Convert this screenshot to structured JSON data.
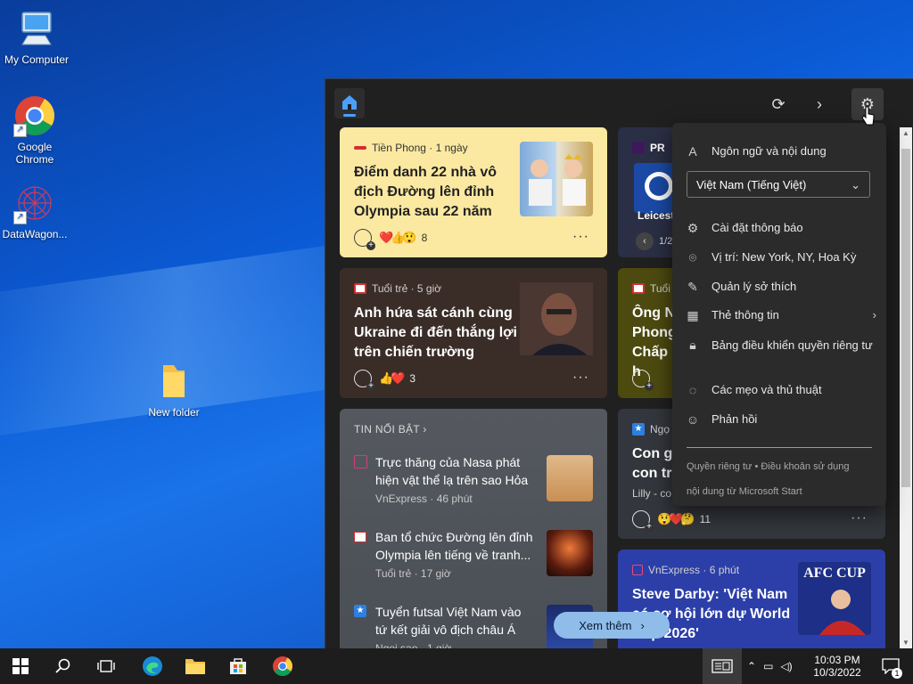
{
  "desktop": {
    "icons": [
      {
        "label": "My Computer"
      },
      {
        "label": "Google Chrome"
      },
      {
        "label": "DataWagon..."
      },
      {
        "label": "New folder"
      }
    ]
  },
  "panel": {
    "cards": {
      "c1": {
        "source": "Tiền Phong · 1 ngày",
        "headline": "Điểm danh 22 nhà vô địch Đường lên đỉnh Olympia sau 22 năm",
        "count": "8"
      },
      "c2": {
        "source": "PR",
        "team": "Leicester",
        "page": "1/2"
      },
      "c3": {
        "source": "Tuổi trẻ · 5 giờ",
        "headline": "Anh hứa sát cánh cùng Ukraine đi đến thắng lợi trên chiến trường",
        "count": "3"
      },
      "c4": {
        "source": "Tuổi",
        "headline": "Ông N Phong Chấp h"
      },
      "c5": {
        "source": "Ngọ",
        "headline": "Con ga con tra",
        "author": "Lilly - co",
        "count": "11"
      },
      "c6": {
        "source": "VnExpress · 6 phút",
        "headline": "Steve Darby: 'Việt Nam có cơ hội lớn dự World Cup 2026'",
        "thumb_text": "AFC CUP"
      }
    },
    "trending": {
      "title": "TIN NỔI BẬT",
      "items": [
        {
          "headline": "Trực thăng của Nasa phát hiện vật thể lạ trên sao Hỏa",
          "meta": "VnExpress · 46 phút"
        },
        {
          "headline": "Ban tổ chức Đường lên đỉnh Olympia lên tiếng về tranh...",
          "meta": "Tuổi trẻ · 17 giờ"
        },
        {
          "headline": "Tuyển futsal Việt Nam vào tứ kết giải vô địch châu Á",
          "meta": "Ngọi sao · 1 giờ"
        }
      ]
    },
    "see_more": "Xem thêm"
  },
  "settings_menu": {
    "language_title": "Ngôn ngữ và nội dung",
    "language_value": "Việt Nam (Tiếng Việt)",
    "items": [
      {
        "label": "Cài đặt thông báo",
        "icon": "gear-icon"
      },
      {
        "label": "Vị trí: New York, NY, Hoa Kỳ",
        "icon": "location-pin-icon"
      },
      {
        "label": "Quản lý sở thích",
        "icon": "pencil-icon"
      },
      {
        "label": "Thẻ thông tin",
        "icon": "cards-icon"
      },
      {
        "label": "Bảng điều khiển quyền riêng tư",
        "icon": "lock-icon"
      },
      {
        "label": "Các mẹo và thủ thuật",
        "icon": "lightbulb-icon"
      },
      {
        "label": "Phản hồi",
        "icon": "feedback-icon"
      }
    ],
    "footer_line1": "Quyền riêng tư • Điều khoản sử dụng",
    "footer_line2": "nội dung từ Microsoft Start"
  },
  "taskbar": {
    "time": "10:03 PM",
    "date": "10/3/2022",
    "notifications": "1"
  },
  "colors": {
    "accent": "#4ba0ff",
    "card_yellow": "#fbe9a1",
    "card_brown": "#3a2d28",
    "card_olive": "#4d4a10",
    "card_gray": "#55595f",
    "card_blue": "#2c3fa8"
  }
}
